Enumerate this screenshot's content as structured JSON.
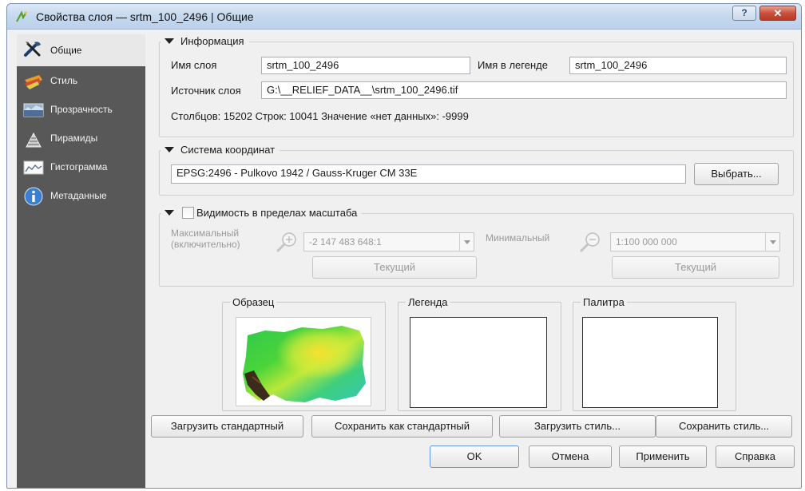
{
  "window": {
    "title": "Свойства слоя — srtm_100_2496 | Общие",
    "help_label": "?",
    "close_label": "✕"
  },
  "sidebar": {
    "items": [
      {
        "label": "Общие",
        "icon": "wrench-screwdriver-icon"
      },
      {
        "label": "Стиль",
        "icon": "paint-brush-icon"
      },
      {
        "label": "Прозрачность",
        "icon": "transparency-icon"
      },
      {
        "label": "Пирамиды",
        "icon": "pyramids-icon"
      },
      {
        "label": "Гистограмма",
        "icon": "histogram-icon"
      },
      {
        "label": "Метаданные",
        "icon": "info-icon"
      }
    ]
  },
  "info": {
    "title": "Информация",
    "layer_name_label": "Имя слоя",
    "layer_name_value": "srtm_100_2496",
    "legend_name_label": "Имя в легенде",
    "legend_name_value": "srtm_100_2496",
    "source_label": "Источник слоя",
    "source_value": "G:\\__RELIEF_DATA__\\srtm_100_2496.tif",
    "stats_text": "Столбцов: 15202  Строк: 10041  Значение «нет данных»: -9999"
  },
  "crs": {
    "title": "Система координат",
    "value": "EPSG:2496 - Pulkovo 1942 / Gauss-Kruger CM 33E",
    "select_button": "Выбрать..."
  },
  "scale": {
    "title": "Видимость в пределах масштаба",
    "checked": false,
    "max_label_1": "Максимальный",
    "max_label_2": "(включительно)",
    "max_value": "-2 147 483 648:1",
    "min_label": "Минимальный",
    "min_value": "1:100 000 000",
    "current_button_left": "Текущий",
    "current_button_right": "Текущий"
  },
  "preview": {
    "sample_title": "Образец",
    "legend_title": "Легенда",
    "palette_title": "Палитра"
  },
  "style_buttons": {
    "load_default": "Загрузить стандартный",
    "save_default": "Сохранить как стандартный",
    "load_style": "Загрузить стиль...",
    "save_style": "Сохранить стиль..."
  },
  "dialog_buttons": {
    "ok": "OK",
    "cancel": "Отмена",
    "apply": "Применить",
    "help": "Справка"
  },
  "colors": {
    "sidebar_bg": "#585858",
    "sidebar_active": "#e8e8e8",
    "dialog_bg": "#f0f0f0"
  }
}
